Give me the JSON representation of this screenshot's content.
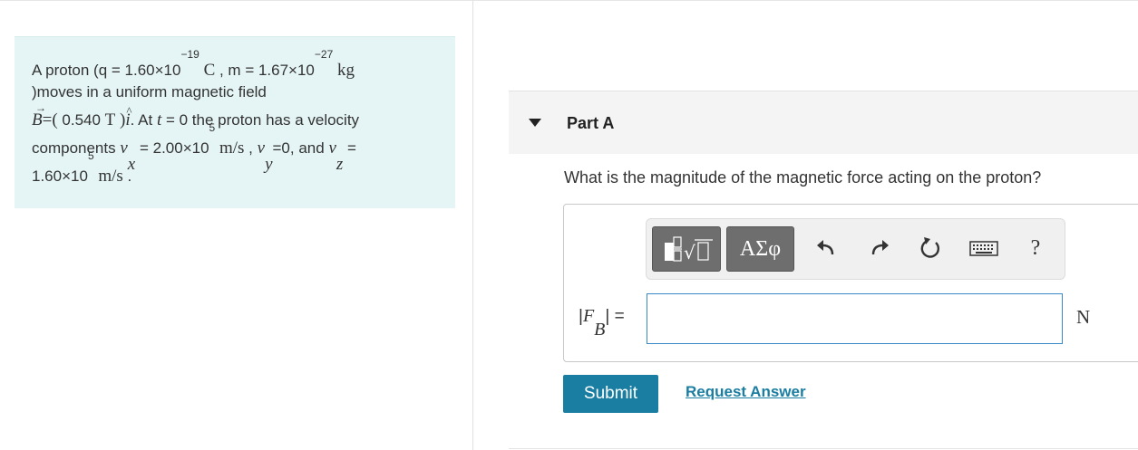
{
  "problem": {
    "l1_a": "A proton (q = 1.60×10",
    "l1_exp1": "−19",
    "l1_unit1": "C",
    "l1_b": ", m = 1.67×10",
    "l1_exp2": "−27",
    "l1_unit2": "kg",
    "l2": ")moves in a uniform magnetic field",
    "l3_B": "B",
    "l3_eq": "=(",
    "l3_val": "0.540",
    "l3_T": "T",
    "l3_close": ")",
    "l3_i": "i",
    "l3_at": ". At",
    "l3_t": "t",
    "l3_rest": "= 0 the proton has a velocity",
    "l4_a": "components",
    "l4_v": "v",
    "l4_x": "x",
    "l4_val": "= 2.00×10",
    "l4_exp": "5",
    "l4_unit": "m/s",
    "l4_comma": ",",
    "l4_vy": "v",
    "l4_y": "y",
    "l4_vyval": "=0, and",
    "l4_vz": "v",
    "l4_z": "z",
    "l4_eq": "=",
    "l5_val": "1.60×10",
    "l5_exp": "5",
    "l5_unit": "m/s",
    "l5_end": "."
  },
  "part": {
    "title": "Part A"
  },
  "question": "What is the magnitude of the magnetic force acting on the proton?",
  "toolbar": {
    "symbols_label": "ΑΣφ",
    "undo_icon": "undo-arrow",
    "redo_icon": "redo-arrow",
    "reset_icon": "reset-circular-arrow",
    "keyboard_icon": "keyboard",
    "help_label": "?"
  },
  "answer": {
    "label_prefix": "|",
    "label_F": "F",
    "label_sub": "B",
    "label_suffix": "| =",
    "value": "",
    "unit": "N"
  },
  "actions": {
    "submit_label": "Submit",
    "request_label": "Request Answer"
  },
  "colors": {
    "accent": "#1a7ea2",
    "problem_bg": "#e5f5f5",
    "input_border": "#3a8ac6"
  }
}
